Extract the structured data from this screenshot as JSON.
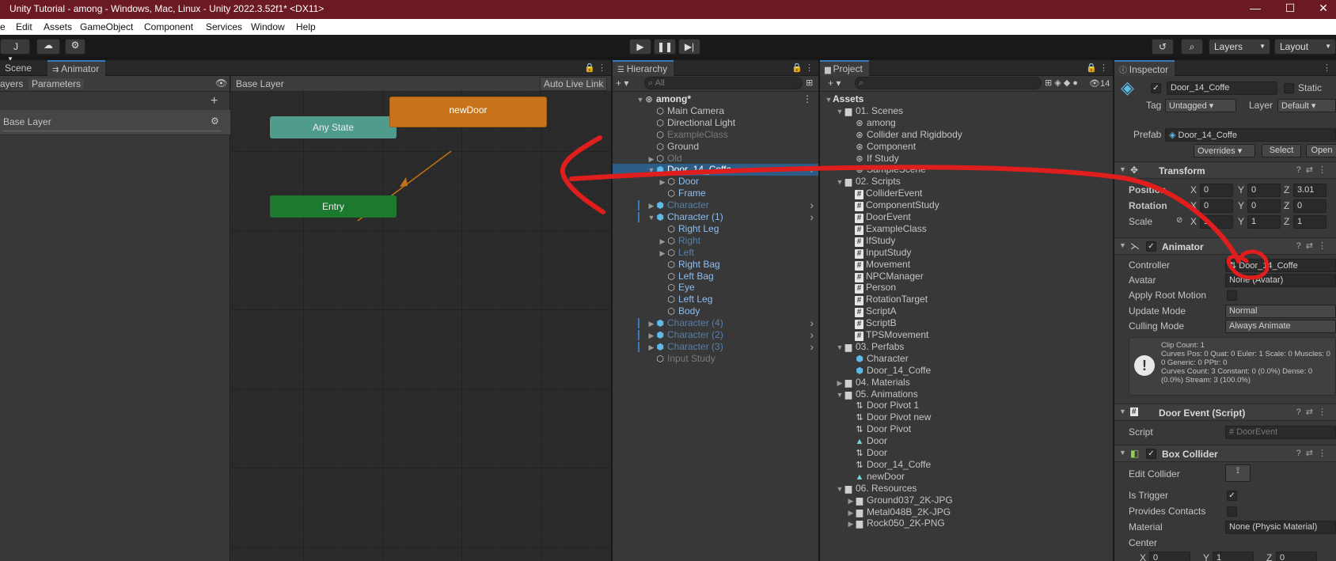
{
  "window": {
    "title": "Unity Tutorial - among - Windows, Mac, Linux - Unity 2022.3.52f1* <DX11>",
    "minimize": "—",
    "maximize": "☐",
    "close": "✕"
  },
  "menu": [
    "e",
    "Edit",
    "Assets",
    "GameObject",
    "Component",
    "Services",
    "Window",
    "Help"
  ],
  "toolbar": {
    "account": "J",
    "layers": "Layers",
    "layout": "Layout"
  },
  "animator_panel": {
    "tabs": [
      "Scene",
      "Animator"
    ],
    "subtabs": [
      "ayers",
      "Parameters"
    ],
    "layer_name": "Base Layer",
    "breadcrumb": "Base Layer",
    "auto_live_link": "Auto Live Link",
    "states": {
      "any_state": "Any State",
      "entry": "Entry",
      "new_door": "newDoor"
    }
  },
  "hierarchy": {
    "tab": "Hierarchy",
    "search_placeholder": "All",
    "items": [
      {
        "label": "among*",
        "indent": 0,
        "icon": "scene",
        "style": "bold",
        "arrow": "open"
      },
      {
        "label": "Main Camera",
        "indent": 1,
        "icon": "cube",
        "style": "",
        "arrow": ""
      },
      {
        "label": "Directional Light",
        "indent": 1,
        "icon": "cube",
        "style": "",
        "arrow": ""
      },
      {
        "label": "ExampleClass",
        "indent": 1,
        "icon": "cube",
        "style": "dim",
        "arrow": ""
      },
      {
        "label": "Ground",
        "indent": 1,
        "icon": "cube",
        "style": "",
        "arrow": ""
      },
      {
        "label": "Old",
        "indent": 1,
        "icon": "cube",
        "style": "dim",
        "arrow": "closed"
      },
      {
        "label": "Door_14_Coffe",
        "indent": 1,
        "icon": "prefab",
        "style": "selected",
        "arrow": "open"
      },
      {
        "label": "Door",
        "indent": 2,
        "icon": "cube",
        "style": "blue",
        "arrow": "closed"
      },
      {
        "label": "Frame",
        "indent": 2,
        "icon": "cube",
        "style": "blue",
        "arrow": ""
      },
      {
        "label": "Character",
        "indent": 1,
        "icon": "prefab",
        "style": "bluedim",
        "arrow": "closed"
      },
      {
        "label": "Character (1)",
        "indent": 1,
        "icon": "prefab",
        "style": "blue",
        "arrow": "open"
      },
      {
        "label": "Right Leg",
        "indent": 2,
        "icon": "cube",
        "style": "blue",
        "arrow": ""
      },
      {
        "label": "Right",
        "indent": 2,
        "icon": "cube",
        "style": "bluedim",
        "arrow": "closed"
      },
      {
        "label": "Left",
        "indent": 2,
        "icon": "cube",
        "style": "bluedim",
        "arrow": "closed"
      },
      {
        "label": "Right Bag",
        "indent": 2,
        "icon": "cube",
        "style": "blue",
        "arrow": ""
      },
      {
        "label": "Left Bag",
        "indent": 2,
        "icon": "cube",
        "style": "blue",
        "arrow": ""
      },
      {
        "label": "Eye",
        "indent": 2,
        "icon": "cube",
        "style": "blue",
        "arrow": ""
      },
      {
        "label": "Left Leg",
        "indent": 2,
        "icon": "cube",
        "style": "blue",
        "arrow": ""
      },
      {
        "label": "Body",
        "indent": 2,
        "icon": "cube",
        "style": "blue",
        "arrow": ""
      },
      {
        "label": "Character (4)",
        "indent": 1,
        "icon": "prefab",
        "style": "bluedim",
        "arrow": "closed"
      },
      {
        "label": "Character (2)",
        "indent": 1,
        "icon": "prefab",
        "style": "bluedim",
        "arrow": "closed"
      },
      {
        "label": "Character (3)",
        "indent": 1,
        "icon": "prefab",
        "style": "bluedim",
        "arrow": "closed"
      },
      {
        "label": "Input Study",
        "indent": 1,
        "icon": "cube",
        "style": "dim",
        "arrow": ""
      }
    ]
  },
  "project": {
    "tab": "Project",
    "hidden_count": "14",
    "items": [
      {
        "label": "Assets",
        "indent": 0,
        "icon": "",
        "style": "bold",
        "arrow": "open"
      },
      {
        "label": "01. Scenes",
        "indent": 1,
        "icon": "folder",
        "arrow": "open"
      },
      {
        "label": "among",
        "indent": 2,
        "icon": "unity",
        "arrow": ""
      },
      {
        "label": "Collider and Rigidbody",
        "indent": 2,
        "icon": "unity",
        "arrow": ""
      },
      {
        "label": "Component",
        "indent": 2,
        "icon": "unity",
        "arrow": ""
      },
      {
        "label": "If Study",
        "indent": 2,
        "icon": "unity",
        "arrow": ""
      },
      {
        "label": "SampleScene",
        "indent": 2,
        "icon": "unity",
        "arrow": ""
      },
      {
        "label": "02. Scripts",
        "indent": 1,
        "icon": "folder",
        "arrow": "open"
      },
      {
        "label": "ColliderEvent",
        "indent": 2,
        "icon": "hash",
        "arrow": ""
      },
      {
        "label": "ComponentStudy",
        "indent": 2,
        "icon": "hash",
        "arrow": ""
      },
      {
        "label": "DoorEvent",
        "indent": 2,
        "icon": "hash",
        "arrow": ""
      },
      {
        "label": "ExampleClass",
        "indent": 2,
        "icon": "hash",
        "arrow": ""
      },
      {
        "label": "IfStudy",
        "indent": 2,
        "icon": "hash",
        "arrow": ""
      },
      {
        "label": "InputStudy",
        "indent": 2,
        "icon": "hash",
        "arrow": ""
      },
      {
        "label": "Movement",
        "indent": 2,
        "icon": "hash",
        "arrow": ""
      },
      {
        "label": "NPCManager",
        "indent": 2,
        "icon": "hash",
        "arrow": ""
      },
      {
        "label": "Person",
        "indent": 2,
        "icon": "hash",
        "arrow": ""
      },
      {
        "label": "RotationTarget",
        "indent": 2,
        "icon": "hash",
        "arrow": ""
      },
      {
        "label": "ScriptA",
        "indent": 2,
        "icon": "hash",
        "arrow": ""
      },
      {
        "label": "ScriptB",
        "indent": 2,
        "icon": "hash",
        "arrow": ""
      },
      {
        "label": "TPSMovement",
        "indent": 2,
        "icon": "hash",
        "arrow": ""
      },
      {
        "label": "03. Perfabs",
        "indent": 1,
        "icon": "folder",
        "arrow": "open"
      },
      {
        "label": "Character",
        "indent": 2,
        "icon": "prefab",
        "arrow": ""
      },
      {
        "label": "Door_14_Coffe",
        "indent": 2,
        "icon": "prefab",
        "arrow": ""
      },
      {
        "label": "04. Materials",
        "indent": 1,
        "icon": "folder",
        "arrow": "closed"
      },
      {
        "label": "05. Animations",
        "indent": 1,
        "icon": "folder",
        "arrow": "open"
      },
      {
        "label": "Door Pivot 1",
        "indent": 2,
        "icon": "controller",
        "arrow": ""
      },
      {
        "label": "Door Pivot new",
        "indent": 2,
        "icon": "controller",
        "arrow": ""
      },
      {
        "label": "Door Pivot",
        "indent": 2,
        "icon": "controller",
        "arrow": ""
      },
      {
        "label": "Door",
        "indent": 2,
        "icon": "anim",
        "arrow": ""
      },
      {
        "label": "Door",
        "indent": 2,
        "icon": "controller",
        "arrow": ""
      },
      {
        "label": "Door_14_Coffe",
        "indent": 2,
        "icon": "controller",
        "arrow": ""
      },
      {
        "label": "newDoor",
        "indent": 2,
        "icon": "anim",
        "arrow": ""
      },
      {
        "label": "06. Resources",
        "indent": 1,
        "icon": "folder",
        "arrow": "open"
      },
      {
        "label": "Ground037_2K-JPG",
        "indent": 2,
        "icon": "folder",
        "arrow": "closed"
      },
      {
        "label": "Metal048B_2K-JPG",
        "indent": 2,
        "icon": "folder",
        "arrow": "closed"
      },
      {
        "label": "Rock050_2K-PNG",
        "indent": 2,
        "icon": "folder",
        "arrow": "closed"
      }
    ]
  },
  "inspector": {
    "tab": "Inspector",
    "object_name": "Door_14_Coffe",
    "static_label": "Static",
    "tag_label": "Tag",
    "tag_value": "Untagged",
    "layer_label": "Layer",
    "layer_value": "Default",
    "prefab_label": "Prefab",
    "prefab_value": "Door_14_Coffe",
    "overrides": "Overrides",
    "select": "Select",
    "open": "Open",
    "transform": {
      "title": "Transform",
      "position_label": "Position",
      "rotation_label": "Rotation",
      "scale_label": "Scale",
      "position": [
        "0",
        "0",
        "3.01"
      ],
      "rotation": [
        "0",
        "0",
        "0"
      ],
      "scale": [
        "1",
        "1",
        "1"
      ],
      "axis_x": "X",
      "axis_y": "Y",
      "axis_z": "Z"
    },
    "animator": {
      "title": "Animator",
      "controller_label": "Controller",
      "controller_value": "Door_14_Coffe",
      "avatar_label": "Avatar",
      "avatar_value": "None (Avatar)",
      "apply_root_motion_label": "Apply Root Motion",
      "update_mode_label": "Update Mode",
      "update_mode_value": "Normal",
      "culling_mode_label": "Culling Mode",
      "culling_mode_value": "Always Animate",
      "info": [
        "Clip Count: 1",
        "Curves Pos: 0 Quat: 0 Euler: 1 Scale: 0 Muscles: 0",
        "0 Generic: 0 PPtr: 0",
        "Curves Count: 3 Constant: 0 (0.0%) Dense: 0",
        "(0.0%) Stream: 3 (100.0%)"
      ]
    },
    "door_event": {
      "title": "Door Event (Script)",
      "script_label": "Script",
      "script_value": "DoorEvent"
    },
    "box_collider": {
      "title": "Box Collider",
      "edit_collider_label": "Edit Collider",
      "is_trigger_label": "Is Trigger",
      "provides_contacts_label": "Provides Contacts",
      "material_label": "Material",
      "material_value": "None (Physic Material)",
      "center_label": "Center",
      "center": [
        "0",
        "1",
        "0"
      ]
    }
  },
  "colors": {
    "titlebar": "#6b1a24",
    "selection": "#2c5d87",
    "annotation": "#e01e1e",
    "new_door_state": "#c9731a",
    "entry_state": "#1c7a2f",
    "any_state": "#4f9c8c"
  }
}
